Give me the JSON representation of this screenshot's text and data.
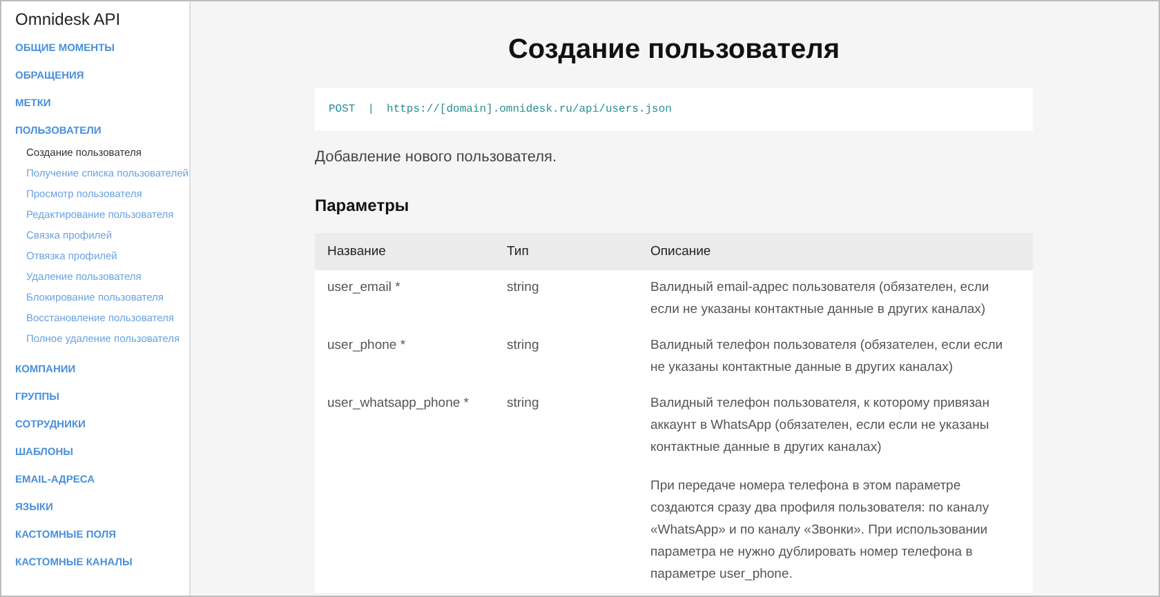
{
  "sidebar": {
    "title": "Omnidesk API",
    "items": [
      {
        "label": "ОБЩИЕ МОМЕНТЫ"
      },
      {
        "label": "ОБРАЩЕНИЯ"
      },
      {
        "label": "МЕТКИ"
      },
      {
        "label": "ПОЛЬЗОВАТЕЛИ",
        "children": [
          {
            "label": "Создание пользователя",
            "selected": true
          },
          {
            "label": "Получение списка пользователей",
            "selected": false
          },
          {
            "label": "Просмотр пользователя",
            "selected": false
          },
          {
            "label": "Редактирование пользователя",
            "selected": false
          },
          {
            "label": "Связка профилей",
            "selected": false
          },
          {
            "label": "Отвязка профилей",
            "selected": false
          },
          {
            "label": "Удаление пользователя",
            "selected": false
          },
          {
            "label": "Блокирование пользователя",
            "selected": false
          },
          {
            "label": "Восстановление пользователя",
            "selected": false
          },
          {
            "label": "Полное удаление пользователя",
            "selected": false
          }
        ]
      },
      {
        "label": "КОМПАНИИ"
      },
      {
        "label": "ГРУППЫ"
      },
      {
        "label": "СОТРУДНИКИ"
      },
      {
        "label": "ШАБЛОНЫ"
      },
      {
        "label": "EMAIL-АДРЕСА"
      },
      {
        "label": "ЯЗЫКИ"
      },
      {
        "label": "КАСТОМНЫЕ ПОЛЯ"
      },
      {
        "label": "КАСТОМНЫЕ КАНАЛЫ"
      }
    ]
  },
  "page": {
    "title": "Создание пользователя",
    "endpoint": {
      "method": "POST",
      "separator": "|",
      "url": "https://[domain].omnidesk.ru/api/users.json"
    },
    "description": "Добавление нового пользователя.",
    "params_heading": "Параметры",
    "table": {
      "columns": [
        "Название",
        "Тип",
        "Описание"
      ],
      "rows": [
        {
          "name": "user_email *",
          "type": "string",
          "description": [
            "Валидный email-адрес пользователя (обязателен, если если не указаны контактные данные в других каналах)"
          ]
        },
        {
          "name": "user_phone *",
          "type": "string",
          "description": [
            "Валидный телефон пользователя (обязателен, если если не указаны контактные данные в других каналах)"
          ]
        },
        {
          "name": "user_whatsapp_phone *",
          "type": "string",
          "description": [
            "Валидный телефон пользователя, к которому привязан аккаунт в WhatsApp (обязателен, если если не указаны контактные данные в других каналах)",
            "При передаче номера телефона в этом параметре создаются сразу два профиля пользователя: по каналу «WhatsApp» и по каналу «Звонки». При использовании параметра не нужно дублировать номер телефона в параметре user_phone."
          ]
        }
      ]
    }
  }
}
